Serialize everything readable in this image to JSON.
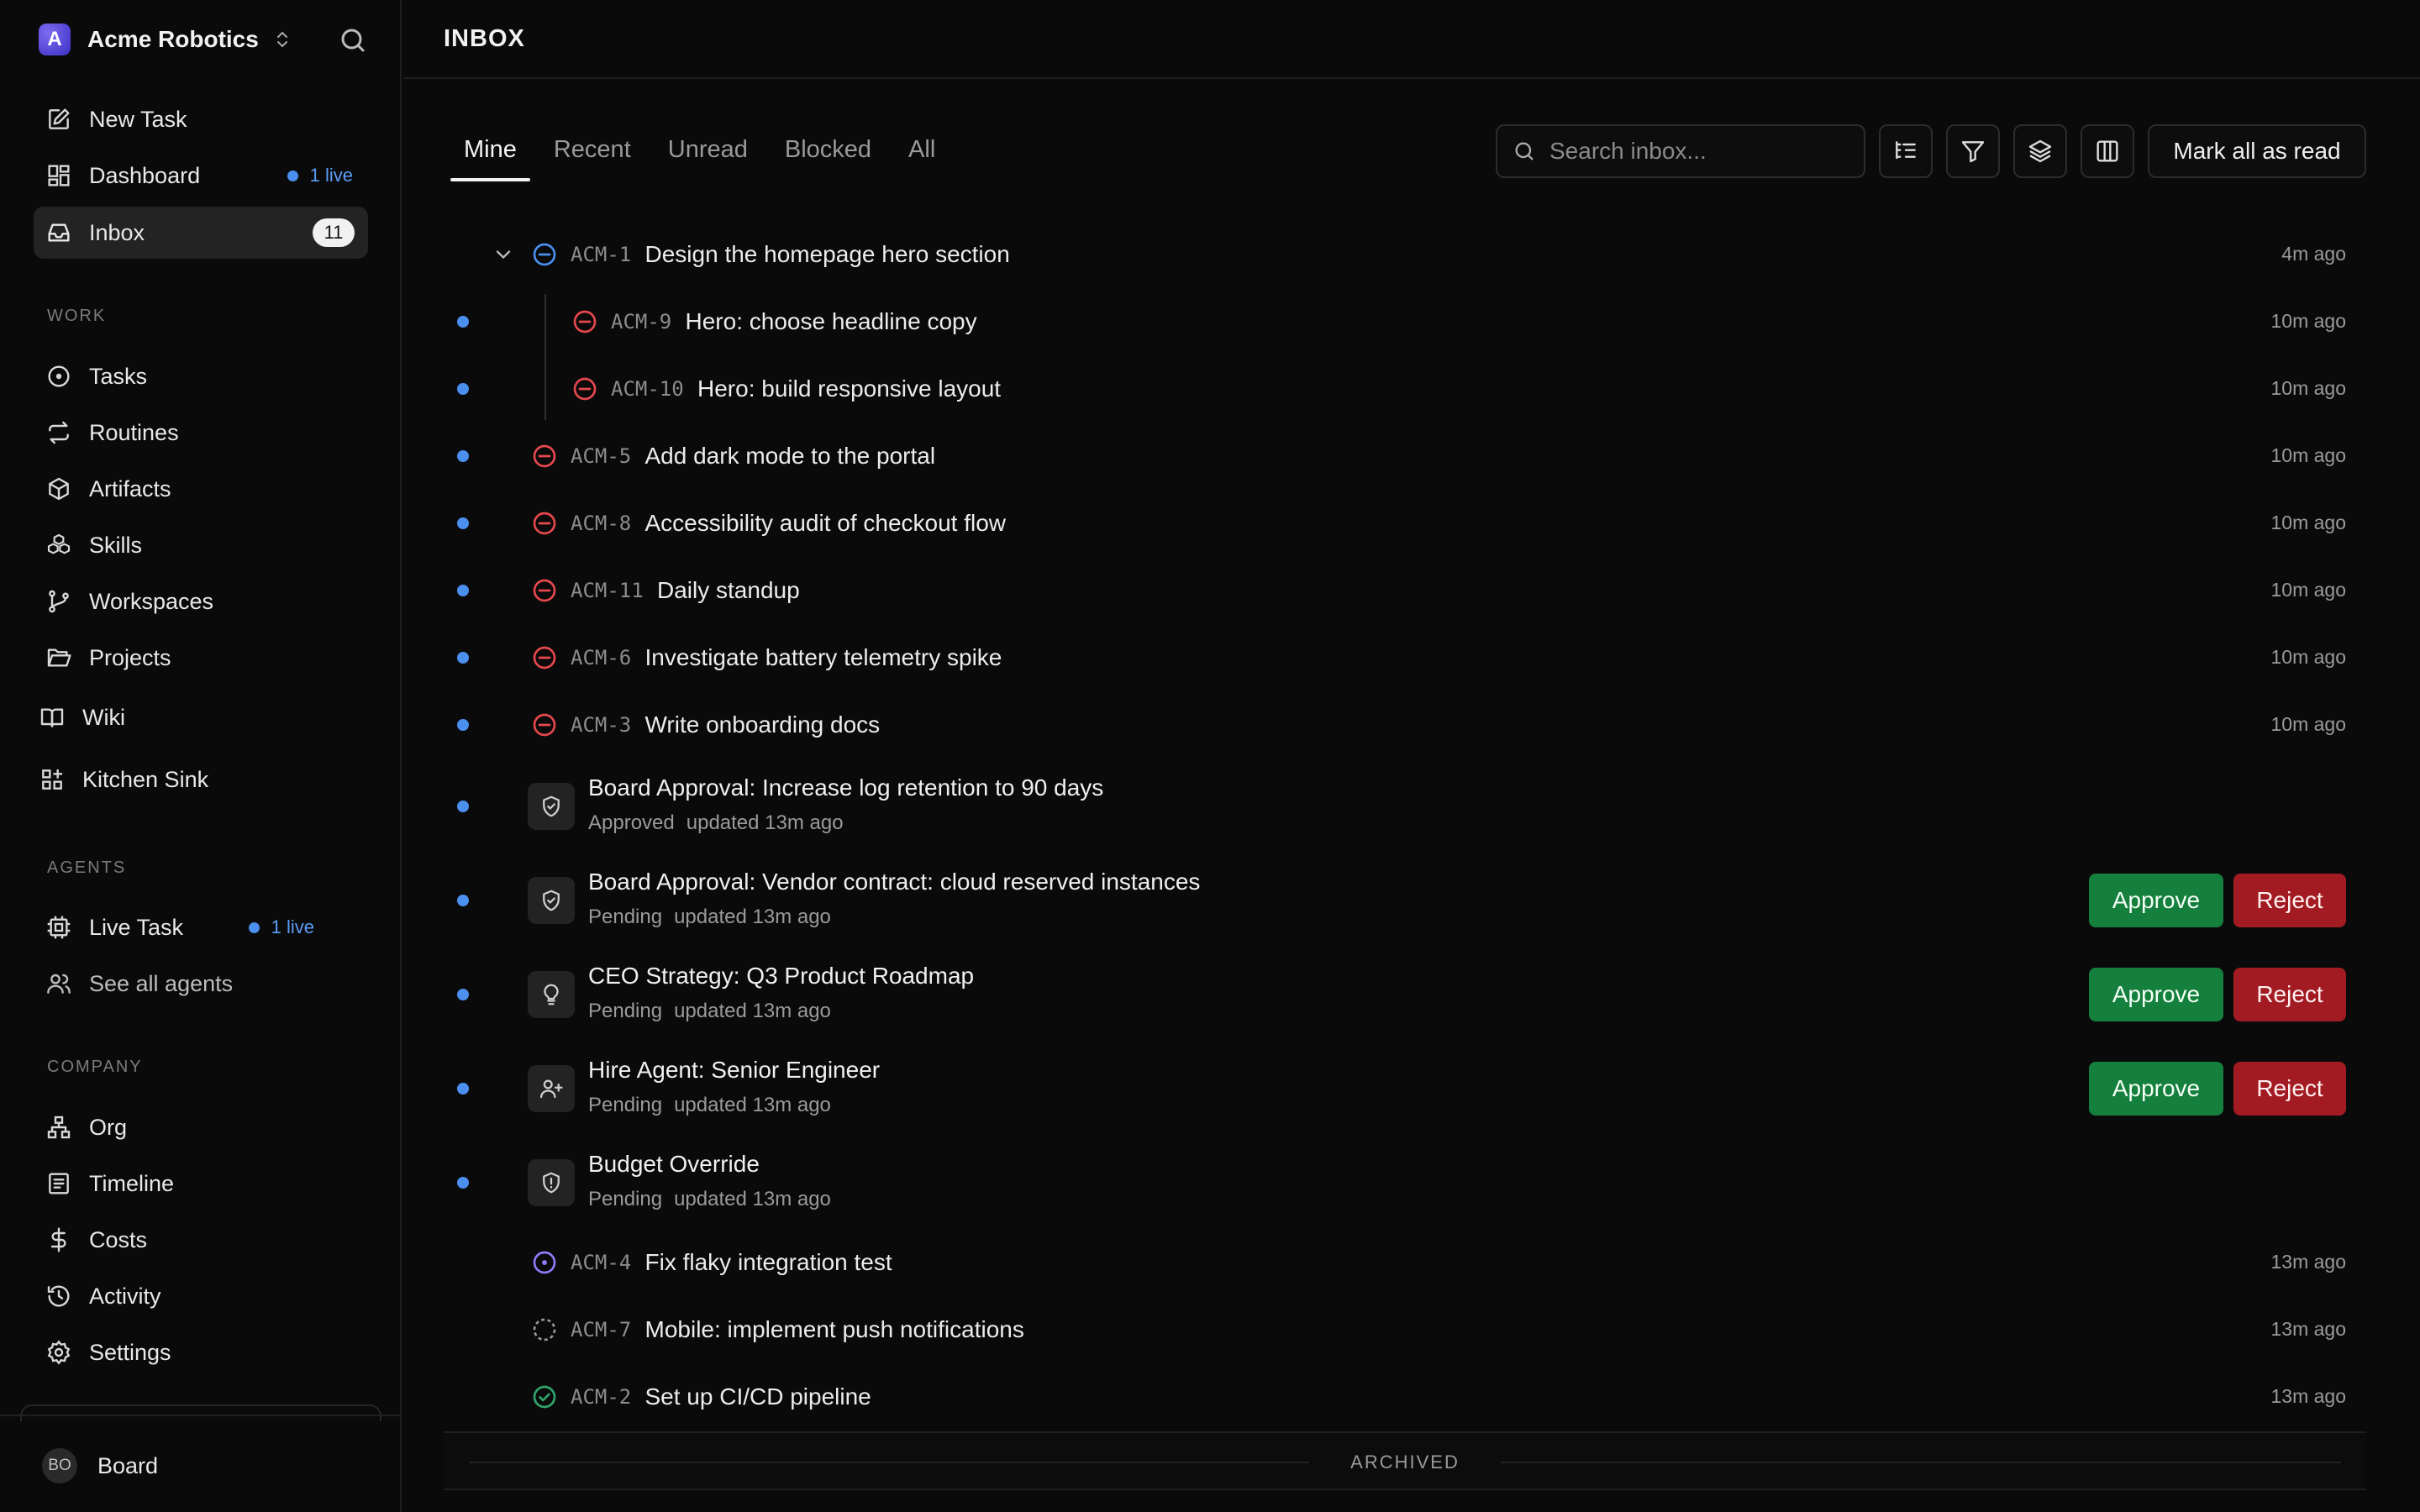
{
  "company": {
    "logo_letter": "A",
    "name": "Acme Robotics"
  },
  "nav": {
    "new_task": "New Task",
    "dashboard": "Dashboard",
    "dashboard_live": "1 live",
    "inbox": "Inbox",
    "inbox_count": "11"
  },
  "work": {
    "title": "WORK",
    "items": [
      "Tasks",
      "Routines",
      "Artifacts",
      "Skills",
      "Workspaces",
      "Projects",
      "Wiki",
      "Kitchen Sink"
    ]
  },
  "agents": {
    "title": "AGENTS",
    "live_task": "Live Task",
    "live_task_live": "1 live",
    "see_all": "See all agents"
  },
  "company_section": {
    "title": "COMPANY",
    "items": [
      "Org",
      "Timeline",
      "Costs",
      "Activity",
      "Settings"
    ]
  },
  "user": {
    "initials": "BO",
    "name": "Board"
  },
  "page": {
    "title": "INBOX"
  },
  "tabs": [
    "Mine",
    "Recent",
    "Unread",
    "Blocked",
    "All"
  ],
  "active_tab": "Mine",
  "search": {
    "placeholder": "Search inbox..."
  },
  "mark_all": "Mark all as read",
  "tasks_top": [
    {
      "id": "ACM-1",
      "title": "Design the homepage hero section",
      "time": "4m ago",
      "status": "in-review",
      "unread": false,
      "expanded": true
    },
    {
      "id": "ACM-9",
      "title": "Hero: choose headline copy",
      "time": "10m ago",
      "status": "blocked",
      "unread": true,
      "child": true
    },
    {
      "id": "ACM-10",
      "title": "Hero: build responsive layout",
      "time": "10m ago",
      "status": "blocked",
      "unread": true,
      "child": true
    },
    {
      "id": "ACM-5",
      "title": "Add dark mode to the portal",
      "time": "10m ago",
      "status": "blocked",
      "unread": true
    },
    {
      "id": "ACM-8",
      "title": "Accessibility audit of checkout flow",
      "time": "10m ago",
      "status": "blocked",
      "unread": true
    },
    {
      "id": "ACM-11",
      "title": "Daily standup",
      "time": "10m ago",
      "status": "blocked",
      "unread": true
    },
    {
      "id": "ACM-6",
      "title": "Investigate battery telemetry spike",
      "time": "10m ago",
      "status": "blocked",
      "unread": true
    },
    {
      "id": "ACM-3",
      "title": "Write onboarding docs",
      "time": "10m ago",
      "status": "blocked",
      "unread": true
    }
  ],
  "approvals": [
    {
      "title": "Board Approval: Increase log retention to 90 days",
      "status": "Approved",
      "updated": "updated 13m ago",
      "icon": "shield-check-icon",
      "actions": false
    },
    {
      "title": "Board Approval: Vendor contract: cloud reserved instances",
      "status": "Pending",
      "updated": "updated 13m ago",
      "icon": "shield-check-icon",
      "actions": true
    },
    {
      "title": "CEO Strategy: Q3 Product Roadmap",
      "status": "Pending",
      "updated": "updated 13m ago",
      "icon": "lightbulb-icon",
      "actions": true
    },
    {
      "title": "Hire Agent: Senior Engineer",
      "status": "Pending",
      "updated": "updated 13m ago",
      "icon": "user-plus-icon",
      "actions": true
    },
    {
      "title": "Budget Override",
      "status": "Pending",
      "updated": "updated 13m ago",
      "icon": "shield-alert-icon",
      "actions": false
    }
  ],
  "approve_label": "Approve",
  "reject_label": "Reject",
  "tasks_bottom": [
    {
      "id": "ACM-4",
      "title": "Fix flaky integration test",
      "time": "13m ago",
      "status": "in-progress"
    },
    {
      "id": "ACM-7",
      "title": "Mobile: implement push notifications",
      "time": "13m ago",
      "status": "todo"
    },
    {
      "id": "ACM-2",
      "title": "Set up CI/CD pipeline",
      "time": "13m ago",
      "status": "done"
    }
  ],
  "archived_label": "ARCHIVED",
  "colors": {
    "accent_blue": "#4b8fef",
    "blocked_red": "#e5484d",
    "in_progress_purple": "#8b7cf6",
    "done_green": "#30a46c",
    "approve_green": "#15803d",
    "reject_red": "#a31b22"
  }
}
